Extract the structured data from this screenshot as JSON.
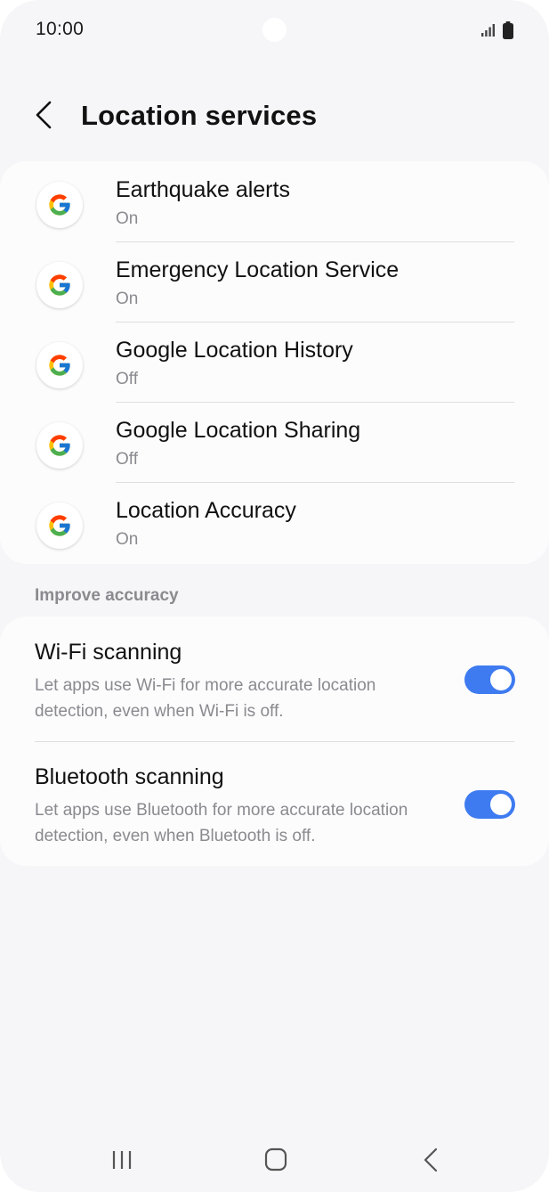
{
  "status_bar": {
    "time": "10:00",
    "icons": [
      "signal-icon",
      "battery-icon"
    ]
  },
  "header": {
    "back_icon": "chevron-left-icon",
    "title": "Location services"
  },
  "services": [
    {
      "title": "Earthquake alerts",
      "status": "On",
      "icon": "google-g-icon"
    },
    {
      "title": "Emergency Location Service",
      "status": "On",
      "icon": "google-g-icon"
    },
    {
      "title": "Google Location History",
      "status": "Off",
      "icon": "google-g-icon"
    },
    {
      "title": "Google Location Sharing",
      "status": "Off",
      "icon": "google-g-icon"
    },
    {
      "title": "Location Accuracy",
      "status": "On",
      "icon": "google-g-icon"
    }
  ],
  "improve": {
    "section_label": "Improve accuracy",
    "items": [
      {
        "title": "Wi-Fi scanning",
        "description": "Let apps use Wi-Fi for more accurate location detection, even when Wi-Fi is off.",
        "enabled": true
      },
      {
        "title": "Bluetooth scanning",
        "description": "Let apps use Bluetooth for more accurate location detection, even when Bluetooth is off.",
        "enabled": true
      }
    ]
  },
  "nav_bar": {
    "buttons": [
      "recent-apps-icon",
      "home-icon",
      "back-icon"
    ]
  },
  "colors": {
    "background": "#f6f6f8",
    "card": "#fcfcfd",
    "toggle_on": "#3e7bf0",
    "secondary_text": "#8a8a8f"
  }
}
